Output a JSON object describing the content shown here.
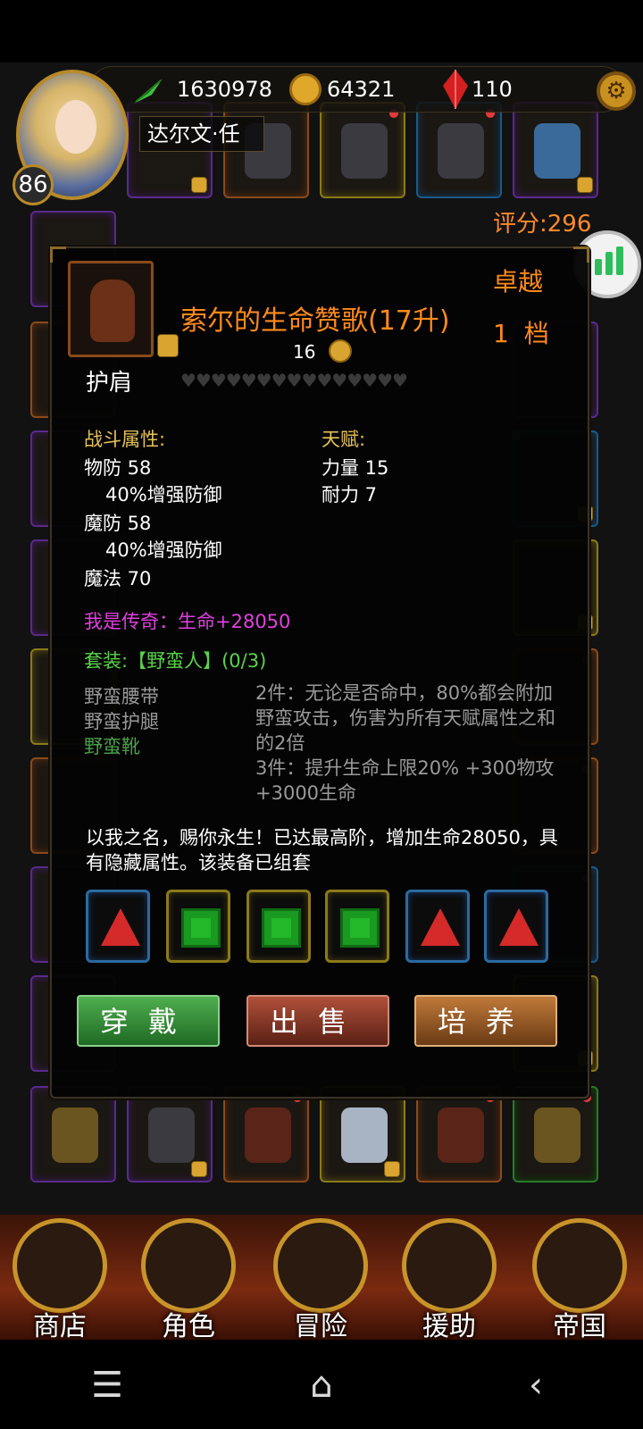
{
  "player": {
    "exp": "1630978",
    "coins": "64321",
    "gems": "110",
    "name": "达尔文·任",
    "level": "86",
    "score": "评分:296"
  },
  "item": {
    "title": "索尔的生命赞歌(17升)",
    "grade": "卓越",
    "tier": "1 档",
    "price": "16",
    "slot_type": "护肩",
    "hearts": "♥♥♥♥♥♥♥♥♥♥♥♥♥♥♥",
    "combat_header": "战斗属性:",
    "talent_header": "天赋:",
    "stats": [
      {
        "label": "物防 58",
        "sub": "40%增强防御"
      },
      {
        "label": "魔防 58",
        "sub": "40%增强防御"
      },
      {
        "label": "魔法 70"
      }
    ],
    "talents": [
      "力量 15",
      "耐力 7"
    ],
    "legend": "我是传奇：生命+28050",
    "set_title": "套装:【野蛮人】(0/3)",
    "set_pieces": [
      "野蛮腰带",
      "野蛮护腿",
      "野蛮靴"
    ],
    "set_bonus_2": "2件：无论是否命中，80%都会附加野蛮攻击，伤害为所有天赋属性之和的2倍",
    "set_bonus_3": "3件：提升生命上限20% +300物攻+3000生命",
    "description": "以我之名，赐你永生！已达最高阶，增加生命28050，具有隐藏属性。该装备已组套",
    "sockets": [
      "red",
      "green",
      "green",
      "green",
      "red",
      "red"
    ]
  },
  "actions": {
    "wear": "穿戴",
    "sell": "出售",
    "cultivate": "培养"
  },
  "nav": [
    "商店",
    "角色",
    "冒险",
    "援助",
    "帝国"
  ],
  "colors": {
    "accent": "#ff8a1a",
    "legend": "#e040e0",
    "set": "#5ad24a",
    "header": "#e6c25a"
  }
}
